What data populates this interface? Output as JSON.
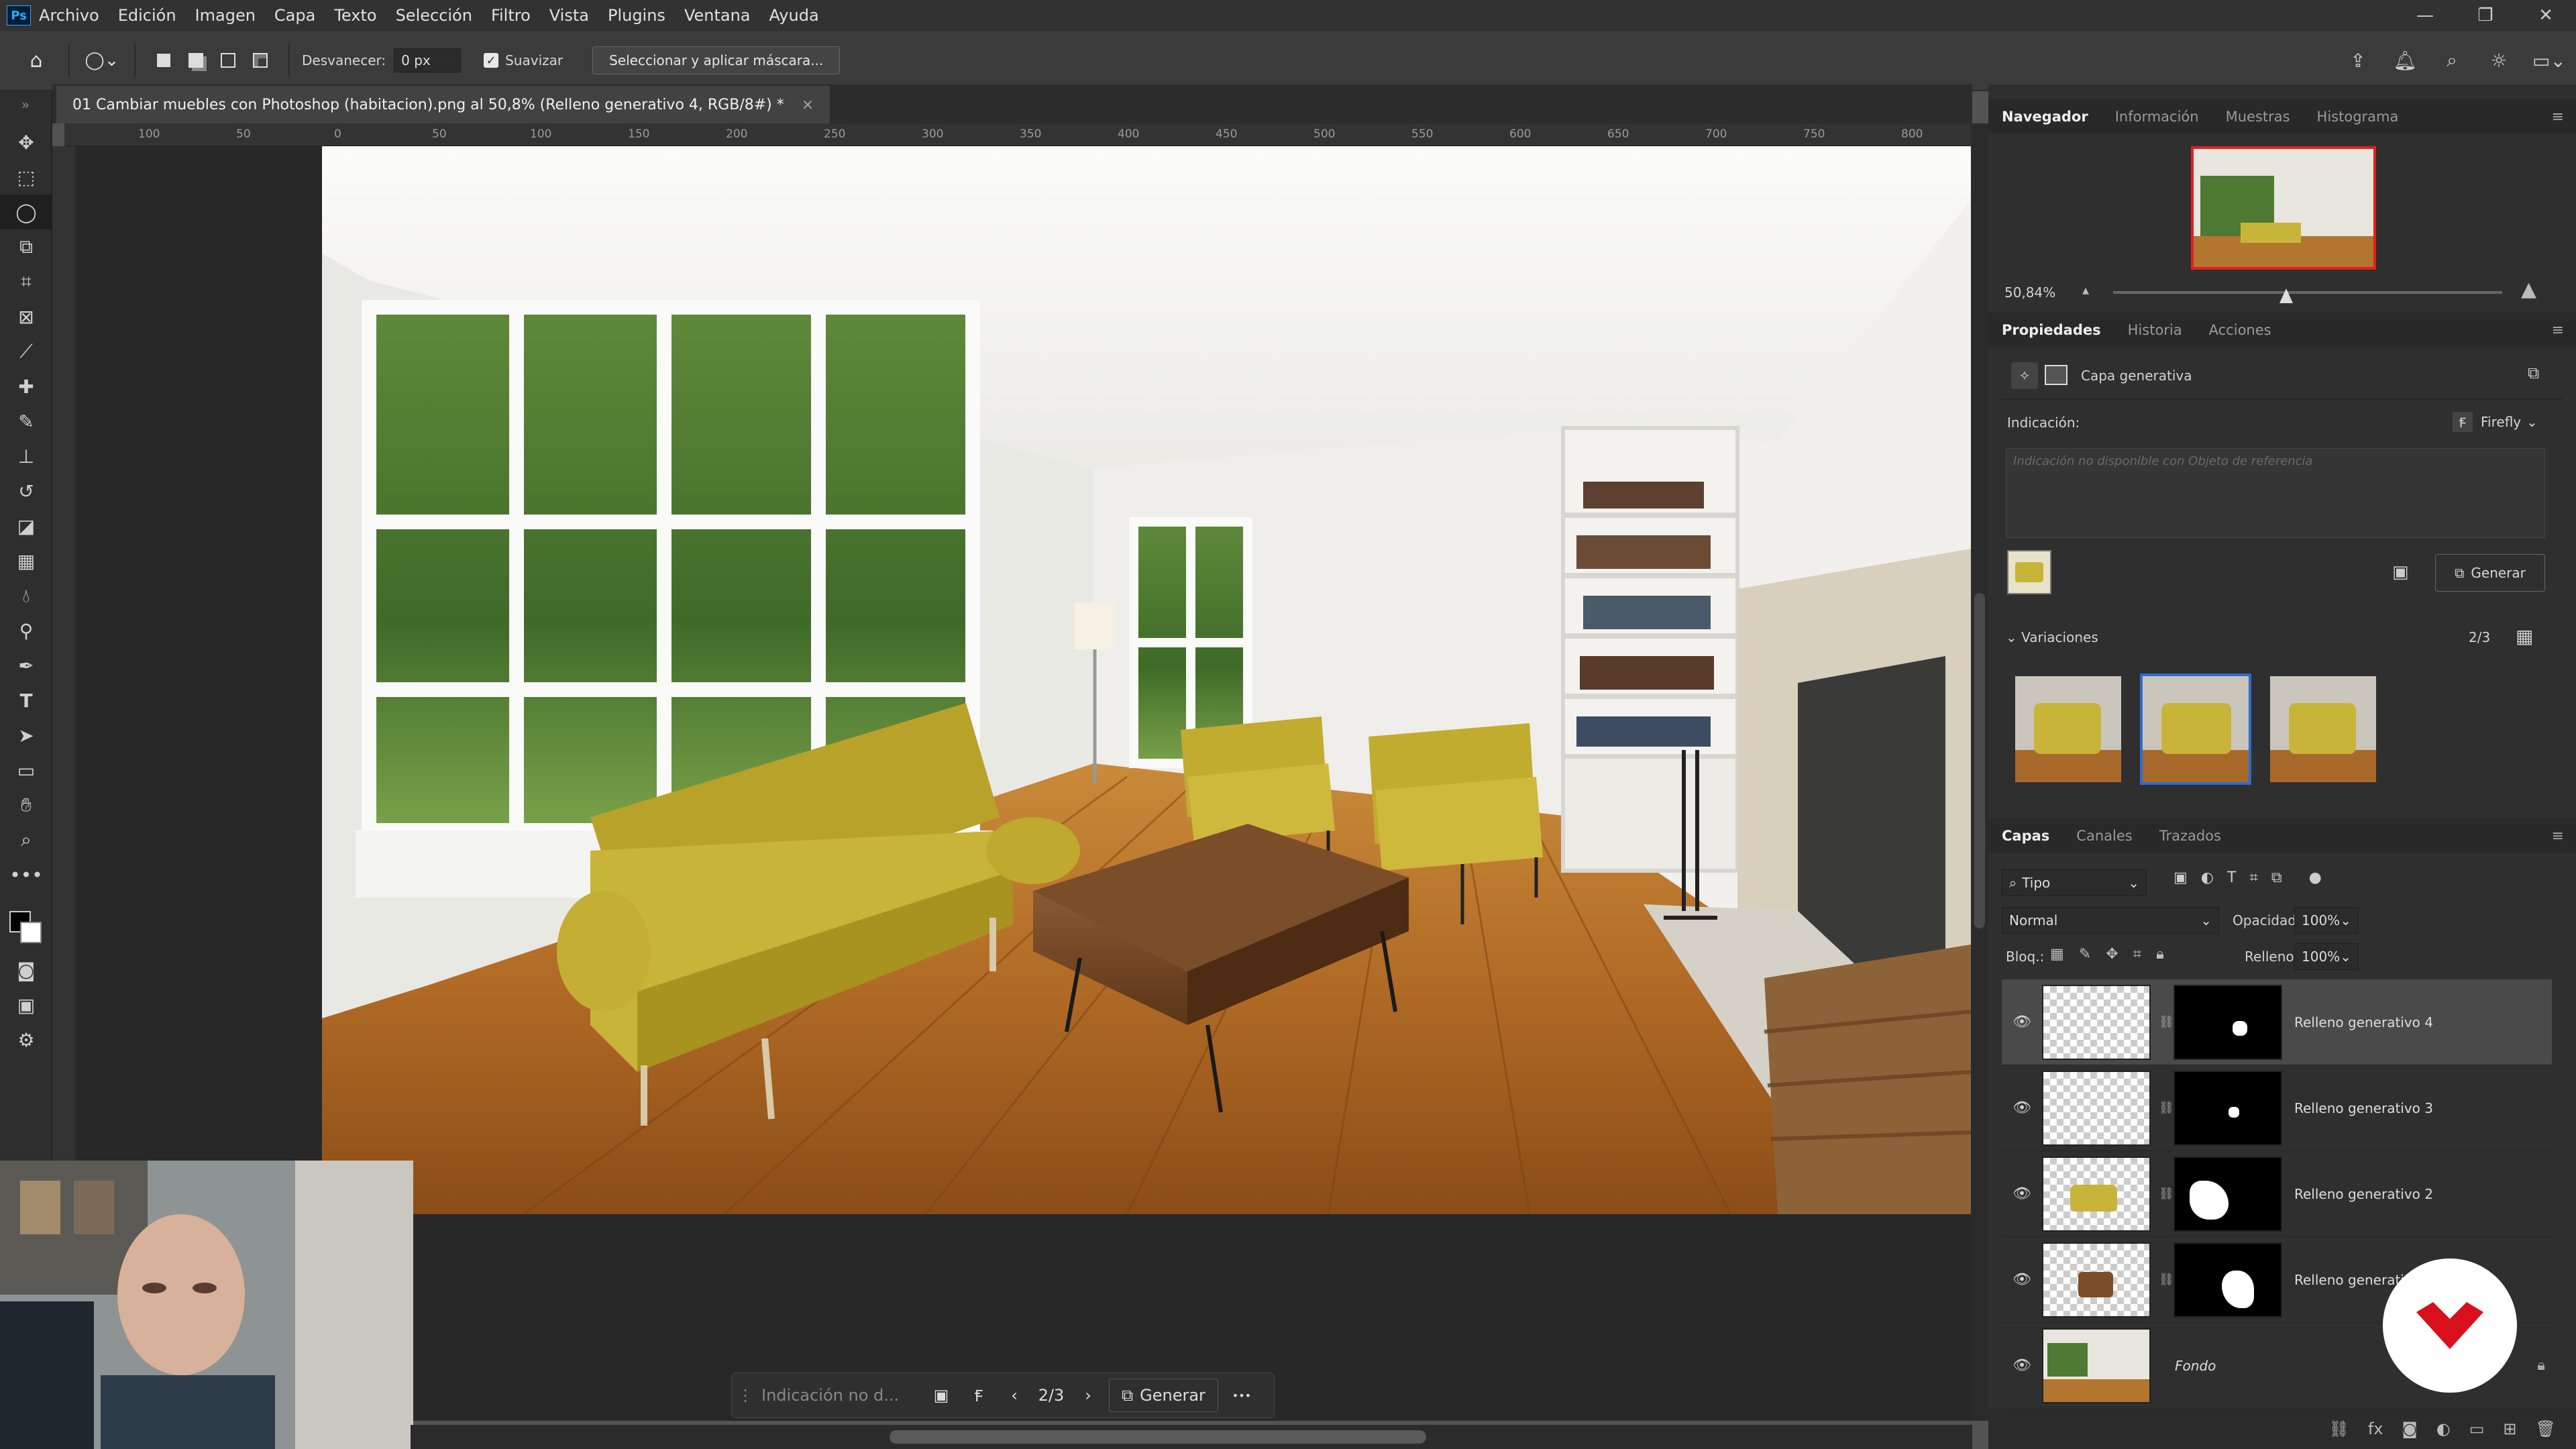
{
  "app": {
    "logo": "Ps",
    "menus": [
      "Archivo",
      "Edición",
      "Imagen",
      "Capa",
      "Texto",
      "Selección",
      "Filtro",
      "Vista",
      "Plugins",
      "Ventana",
      "Ayuda"
    ]
  },
  "options": {
    "feather_label": "Desvanecer:",
    "feather_value": "0 px",
    "smooth_label": "Suavizar",
    "select_mask_button": "Seleccionar y aplicar máscara..."
  },
  "document": {
    "tab_title": "01 Cambiar muebles con Photoshop (habitacion).png al 50,8% (Relleno generativo 4, RGB/8#) *",
    "close": "×"
  },
  "ruler": {
    "h_ticks": [
      "100",
      "50",
      "0",
      "50",
      "100",
      "150",
      "200",
      "250",
      "300",
      "350",
      "400",
      "450",
      "500",
      "550",
      "600",
      "650",
      "700",
      "750",
      "800"
    ]
  },
  "navigator": {
    "tabs": [
      "Navegador",
      "Información",
      "Muestras",
      "Histograma"
    ],
    "zoom": "50,84%"
  },
  "properties": {
    "tabs": [
      "Propiedades",
      "Historia",
      "Acciones"
    ],
    "layer_type": "Capa generativa",
    "prompt_label": "Indicación:",
    "model": "Firefly",
    "prompt_placeholder": "Indicación no disponible con Objeto de referencia",
    "generate": "Generar",
    "variations_label": "Variaciones",
    "variations_count": "2/3"
  },
  "layers_panel": {
    "tabs": [
      "Capas",
      "Canales",
      "Trazados"
    ],
    "filter": "Tipo",
    "blend_mode": "Normal",
    "opacity_label": "Opacidad:",
    "opacity": "100%",
    "lock_label": "Bloq.:",
    "fill_label": "Relleno:",
    "fill": "100%",
    "layers": [
      {
        "name": "Relleno generativo 4"
      },
      {
        "name": "Relleno generativo 3"
      },
      {
        "name": "Relleno generativo 2"
      },
      {
        "name": "Relleno generativo"
      },
      {
        "name": "Fondo"
      }
    ]
  },
  "context_bar": {
    "prompt_placeholder": "Indicación no d...",
    "counter": "2/3",
    "generate": "Generar",
    "more": "•••"
  },
  "colors": {
    "accent": "#31a8ff",
    "selection": "#2d6bd1",
    "logo_red": "#d7101b"
  }
}
